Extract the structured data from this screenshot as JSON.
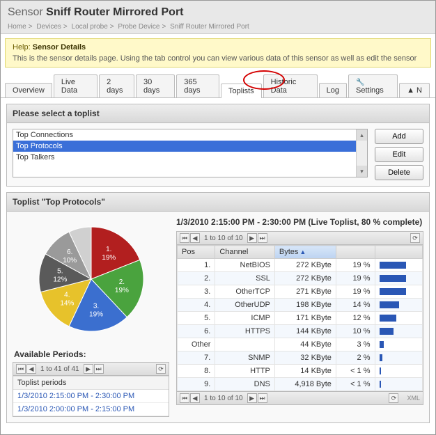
{
  "header": {
    "label": "Sensor",
    "title": "Sniff Router Mirrored Port"
  },
  "breadcrumb": [
    "Home",
    "Devices",
    "Local probe",
    "Probe Device",
    "Sniff Router Mirrored Port"
  ],
  "help": {
    "label": "Help:",
    "title": "Sensor Details",
    "desc": "This is the sensor details page. Using the tab control you can view various data of this sensor as well as edit the sensor"
  },
  "tabs": {
    "items": [
      "Overview",
      "Live Data",
      "2 days",
      "30 days",
      "365 days",
      "Toplists",
      "Historic Data",
      "Log"
    ],
    "active": 5,
    "settings": "Settings",
    "extra": "N"
  },
  "select_panel": {
    "header": "Please select a toplist",
    "items": [
      "Top Connections",
      "Top Protocols",
      "Top Talkers"
    ],
    "selected": 1,
    "buttons": {
      "add": "Add",
      "edit": "Edit",
      "delete": "Delete"
    }
  },
  "toplist_panel": {
    "header": "Toplist \"Top Protocols\""
  },
  "chart_data": {
    "type": "pie",
    "slices": [
      {
        "label": "1.",
        "pct": "19%",
        "value": 19,
        "color": "#b21f1f"
      },
      {
        "label": "2.",
        "pct": "19%",
        "value": 19,
        "color": "#4aa33e"
      },
      {
        "label": "3.",
        "pct": "19%",
        "value": 19,
        "color": "#3b6fcf"
      },
      {
        "label": "4.",
        "pct": "14%",
        "value": 14,
        "color": "#e7c22b"
      },
      {
        "label": "5.",
        "pct": "12%",
        "value": 12,
        "color": "#5a5a5a"
      },
      {
        "label": "6.",
        "pct": "10%",
        "value": 10,
        "color": "#9a9a9a"
      },
      {
        "label": "",
        "pct": "",
        "value": 7,
        "color": "#d0d0d0"
      }
    ]
  },
  "periods": {
    "header": "Available Periods:",
    "pager": "1 to 41 of 41",
    "column": "Toplist periods",
    "rows": [
      "1/3/2010 2:15:00 PM - 2:30:00 PM",
      "1/3/2010 2:00:00 PM - 2:15:00 PM"
    ]
  },
  "grid": {
    "title": "1/3/2010 2:15:00 PM - 2:30:00 PM (Live Toplist, 80 % complete)",
    "pager_top": "1 to 10 of 10",
    "pager_bottom": "1 to 10 of 10",
    "xml": "XML",
    "columns": [
      "Pos",
      "Channel",
      "Bytes",
      "",
      ""
    ],
    "sorted_col": 2,
    "rows": [
      {
        "pos": "1.",
        "channel": "NetBIOS",
        "bytes": "272 KByte",
        "pct": "19 %",
        "bar": 19
      },
      {
        "pos": "2.",
        "channel": "SSL",
        "bytes": "272 KByte",
        "pct": "19 %",
        "bar": 19
      },
      {
        "pos": "3.",
        "channel": "OtherTCP",
        "bytes": "271 KByte",
        "pct": "19 %",
        "bar": 19
      },
      {
        "pos": "4.",
        "channel": "OtherUDP",
        "bytes": "198 KByte",
        "pct": "14 %",
        "bar": 14
      },
      {
        "pos": "5.",
        "channel": "ICMP",
        "bytes": "171 KByte",
        "pct": "12 %",
        "bar": 12
      },
      {
        "pos": "6.",
        "channel": "HTTPS",
        "bytes": "144 KByte",
        "pct": "10 %",
        "bar": 10
      },
      {
        "pos": "Other",
        "channel": "",
        "bytes": "44 KByte",
        "pct": "3 %",
        "bar": 3
      },
      {
        "pos": "7.",
        "channel": "SNMP",
        "bytes": "32 KByte",
        "pct": "2 %",
        "bar": 2
      },
      {
        "pos": "8.",
        "channel": "HTTP",
        "bytes": "14 KByte",
        "pct": "< 1 %",
        "bar": 1
      },
      {
        "pos": "9.",
        "channel": "DNS",
        "bytes": "4,918 Byte",
        "pct": "< 1 %",
        "bar": 1
      }
    ]
  }
}
